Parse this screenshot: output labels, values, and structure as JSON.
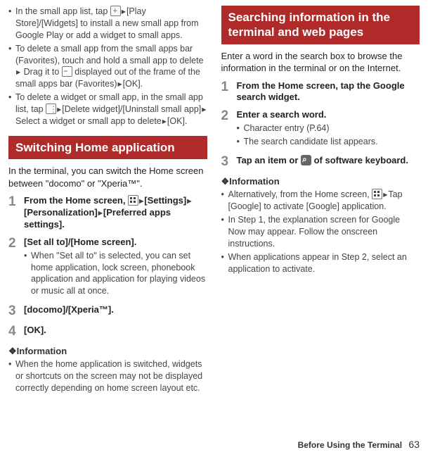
{
  "left": {
    "top_bullets": [
      "In the small app list, tap [icon-plus]▶[Play Store]/[Widgets] to install a new small app from Google Play or add a widget to small apps.",
      "To delete a small app from the small apps bar (Favorites), touch and hold a small app to delete▶ Drag it to [icon-screen] displayed out of the frame of the small apps bar (Favorites)▶[OK].",
      "To delete a widget or small app, in the small app list, tap [icon-menu]▶[Delete widget]/[Uninstall small app]▶Select a widget or small app to delete▶[OK]."
    ],
    "header": "Switching Home application",
    "intro": "In the terminal, you can switch the Home screen between \"docomo\" or \"Xperia™\".",
    "steps": [
      {
        "num": "1",
        "title": "From the Home screen, [icon-grid]▶[Settings]▶[Personalization]▶[Preferred apps settings]."
      },
      {
        "num": "2",
        "title": "[Set all to]/[Home screen].",
        "subs": [
          "When \"Set all to\" is selected, you can set home application, lock screen, phonebook application and application for playing videos or music all at once."
        ]
      },
      {
        "num": "3",
        "title": "[docomo]/[Xperia™]."
      },
      {
        "num": "4",
        "title": "[OK]."
      }
    ],
    "info_label": "Information",
    "info_bullets": [
      "When the home application is switched, widgets or shortcuts on the screen may not be displayed correctly depending on home screen layout etc."
    ]
  },
  "right": {
    "header": "Searching information in the terminal and web pages",
    "intro": "Enter a word in the search box to browse the information in the terminal or on the Internet.",
    "steps": [
      {
        "num": "1",
        "title": "From the Home screen, tap the Google search widget."
      },
      {
        "num": "2",
        "title": "Enter a search word.",
        "subs": [
          "Character entry (P.64)",
          "The search candidate list appears."
        ]
      },
      {
        "num": "3",
        "title": "Tap an item or [icon-search] of software keyboard."
      }
    ],
    "info_label": "Information",
    "info_bullets": [
      "Alternatively, from the Home screen, [icon-grid]▶Tap [Google] to activate [Google] application.",
      "In Step 1, the explanation screen for Google Now may appear. Follow the onscreen instructions.",
      "When applications appear in Step 2, select an application to activate."
    ]
  },
  "footer": {
    "section": "Before Using the Terminal",
    "page": "63"
  }
}
